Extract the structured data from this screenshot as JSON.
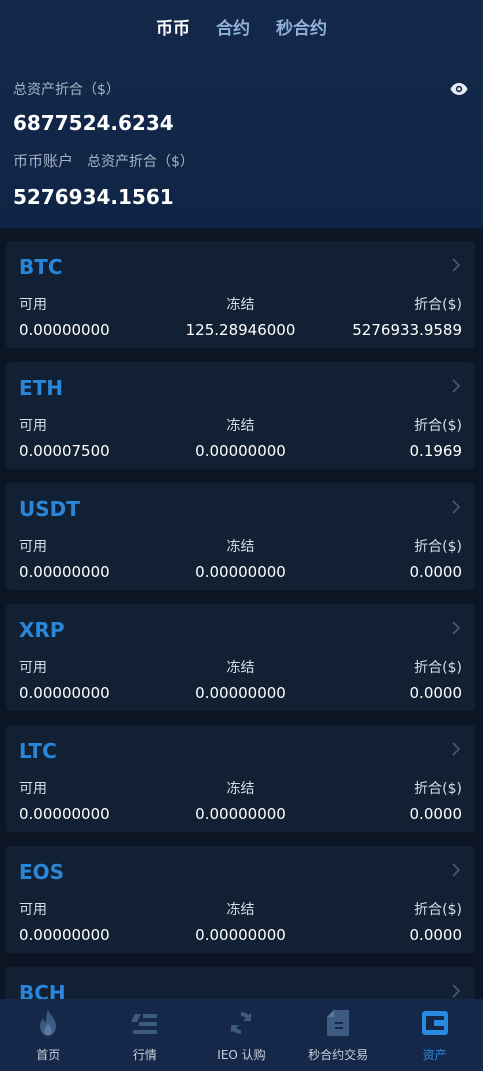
{
  "tabs": [
    "币币",
    "合约",
    "秒合约"
  ],
  "active_tab": 0,
  "summary": {
    "total_label": "总资产折合（$）",
    "total_value": "6877524.6234",
    "account_label": "币币账户",
    "account_total_label": "总资产折合（$）",
    "account_value": "5276934.1561"
  },
  "columns": {
    "available": "可用",
    "frozen": "冻结",
    "converted": "折合($)"
  },
  "assets": [
    {
      "symbol": "BTC",
      "available": "0.00000000",
      "frozen": "125.28946000",
      "converted": "5276933.9589"
    },
    {
      "symbol": "ETH",
      "available": "0.00007500",
      "frozen": "0.00000000",
      "converted": "0.1969"
    },
    {
      "symbol": "USDT",
      "available": "0.00000000",
      "frozen": "0.00000000",
      "converted": "0.0000"
    },
    {
      "symbol": "XRP",
      "available": "0.00000000",
      "frozen": "0.00000000",
      "converted": "0.0000"
    },
    {
      "symbol": "LTC",
      "available": "0.00000000",
      "frozen": "0.00000000",
      "converted": "0.0000"
    },
    {
      "symbol": "EOS",
      "available": "0.00000000",
      "frozen": "0.00000000",
      "converted": "0.0000"
    },
    {
      "symbol": "BCH",
      "available": "",
      "frozen": "",
      "converted": ""
    }
  ],
  "nav": [
    {
      "label": "首页",
      "icon": "flame-icon"
    },
    {
      "label": "行情",
      "icon": "market-icon"
    },
    {
      "label": "IEO 认购",
      "icon": "refresh-icon"
    },
    {
      "label": "秒合约交易",
      "icon": "document-icon"
    },
    {
      "label": "资产",
      "icon": "wallet-icon"
    }
  ],
  "active_nav": 4,
  "colors": {
    "accent": "#2a86d8",
    "background": "#0b1524",
    "card": "#112033",
    "header": "#14294a"
  }
}
